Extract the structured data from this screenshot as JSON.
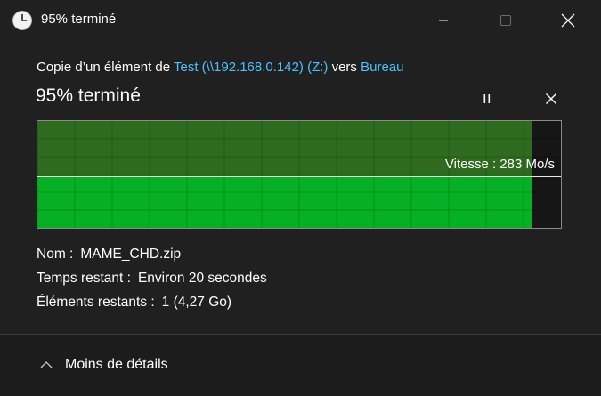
{
  "window": {
    "title": "95% terminé",
    "icon": "clock-icon",
    "controls": [
      "minimize-icon",
      "maximize-icon",
      "close-icon"
    ]
  },
  "copy": {
    "prefix": "Copie d’un élément de ",
    "source": "Test (\\\\192.168.0.142) (Z:)",
    "middle": " vers ",
    "destination": "Bureau"
  },
  "progress": {
    "heading": "95% terminé",
    "fraction": 0.95,
    "speed_label": "Vitesse : 283 Mo/s"
  },
  "details": {
    "name_label": "Nom :",
    "name_value": "MAME_CHD.zip",
    "time_label": "Temps restant :",
    "time_value": "Environ 20 secondes",
    "items_label": "Éléments restants :",
    "items_value": "1 (4,27 Go)"
  },
  "footer": {
    "toggle_label": "Moins de détails",
    "toggle_icon": "chevron-up-icon"
  },
  "colors": {
    "background": "#202020",
    "accent_link": "#4cc2ff",
    "progress_bright": "#06b025",
    "progress_dark": "#2f6b1e"
  }
}
